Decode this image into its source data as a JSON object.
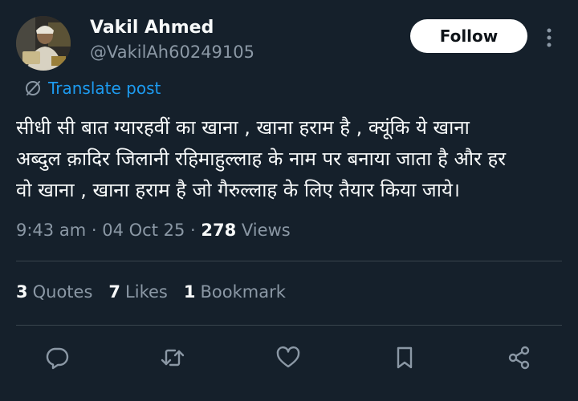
{
  "author": {
    "name": "Vakil Ahmed",
    "handle": "@VakilAh60249105"
  },
  "header": {
    "follow_label": "Follow"
  },
  "translate": {
    "label": "Translate post"
  },
  "post": {
    "text": "सीधी सी बात ग्यारहवीं का खाना , खाना हराम है , क्यूंकि ये खाना\nअब्दुल क़ादिर जिलानी रहिमाहुल्लाह के नाम पर बनाया जाता है और हर\nवो खाना , खाना हराम है जो गैरुल्लाह के लिए तैयार किया जाये।"
  },
  "meta": {
    "time": "9:43 am",
    "date": "04 Oct 25",
    "views_count": "278",
    "views_label": "Views"
  },
  "stats": {
    "quotes_count": "3",
    "quotes_label": "Quotes",
    "likes_count": "7",
    "likes_label": "Likes",
    "bookmarks_count": "1",
    "bookmarks_label": "Bookmark"
  },
  "colors": {
    "background": "#15202b",
    "accent": "#1d9bf0",
    "secondary_text": "#8b98a5",
    "primary_text": "#f7f9f9"
  },
  "icons": {
    "more": "more-vertical-icon",
    "translate": "globe-icon",
    "reply": "reply-icon",
    "repost": "repost-icon",
    "like": "heart-icon",
    "bookmark": "bookmark-icon",
    "share": "share-icon"
  }
}
